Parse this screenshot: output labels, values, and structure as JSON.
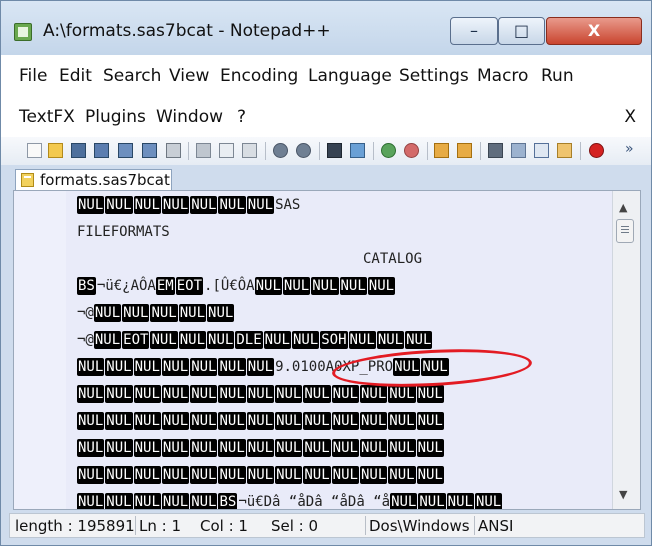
{
  "window": {
    "title": "A:\\formats.sas7bcat - Notepad++",
    "min": "–",
    "max": "□",
    "close": "X"
  },
  "menu": {
    "row1": [
      "File",
      "Edit",
      "Search",
      "View",
      "Encoding",
      "Language",
      "Settings",
      "Macro",
      "Run"
    ],
    "row2": [
      "TextFX",
      "Plugins",
      "Window",
      "?"
    ],
    "close_doc": "X"
  },
  "tab": {
    "label": "formats.sas7bcat"
  },
  "editor": {
    "lines": [
      "NUL NUL NUL NUL NUL NUL NUL SAS",
      "FILEFORMATS",
      "CATALOG",
      "BS ¬ü€¿AÔA EM EOT .[Û€ÔA NUL NUL NUL NUL NUL",
      "¬@ NUL NUL NUL NUL NUL",
      "¬@ NUL EOT NUL NUL NUL DLE NUL NUL SOH NUL NUL NUL",
      "NUL NUL NUL NUL NUL NUL NUL 9.0100A0XP_PRO NUL NUL",
      "NUL NUL NUL NUL NUL NUL NUL NUL NUL NUL NUL NUL NUL",
      "NUL NUL NUL NUL NUL NUL NUL NUL NUL NUL NUL NUL NUL",
      "NUL NUL NUL NUL NUL NUL NUL NUL NUL NUL NUL NUL NUL",
      "NUL NUL NUL NUL NUL BS ¬ü€Dâ “åDâ “åDâ “å NUL NUL NUL NUL"
    ]
  },
  "status": {
    "length": "length : 195891",
    "ln": "Ln : 1",
    "col": "Col : 1",
    "sel": "Sel : 0",
    "eol": "Dos\\Windows",
    "encoding": "ANSI"
  },
  "colors": {
    "annotation_red": "#e31b23",
    "editor_bg": "#e9ebf9",
    "control_token_bg": "#000000"
  },
  "icons": {
    "toolbar": [
      "new-file-icon",
      "open-folder-icon",
      "save-icon",
      "save-all-icon",
      "close-icon",
      "close-all-icon",
      "print-icon",
      "cut-icon",
      "copy-icon",
      "paste-icon",
      "undo-icon",
      "redo-icon",
      "find-icon",
      "replace-icon",
      "zoom-in-icon",
      "zoom-out-icon",
      "sync-v-icon",
      "sync-h-icon",
      "wrap-icon",
      "all-chars-icon",
      "indent-guide-icon",
      "bookmark-icon",
      "record-macro-icon",
      "overflow-icon"
    ]
  }
}
